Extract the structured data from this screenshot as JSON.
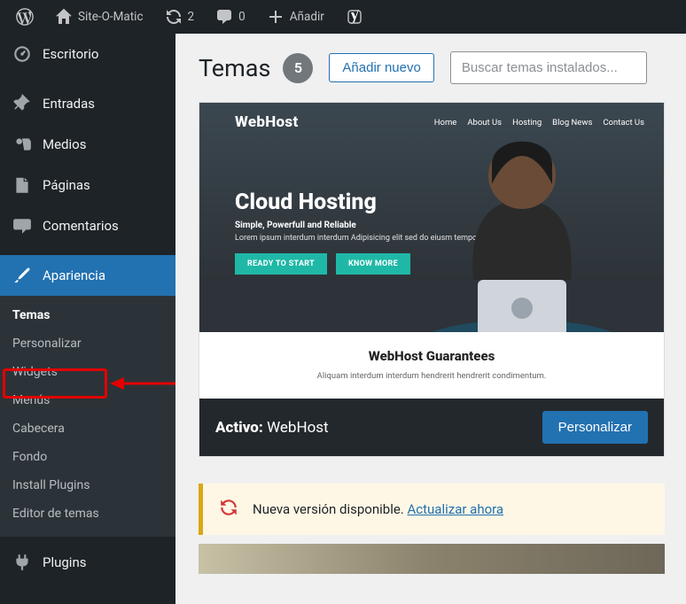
{
  "adminbar": {
    "site_name": "Site-O-Matic",
    "updates_count": "2",
    "comments_count": "0",
    "add_label": "Añadir"
  },
  "sidebar": {
    "items": [
      {
        "label": "Escritorio"
      },
      {
        "label": "Entradas"
      },
      {
        "label": "Medios"
      },
      {
        "label": "Páginas"
      },
      {
        "label": "Comentarios"
      },
      {
        "label": "Apariencia"
      },
      {
        "label": "Plugins"
      }
    ],
    "appearance_submenu": [
      {
        "label": "Temas"
      },
      {
        "label": "Personalizar"
      },
      {
        "label": "Widgets"
      },
      {
        "label": "Menús"
      },
      {
        "label": "Cabecera"
      },
      {
        "label": "Fondo"
      },
      {
        "label": "Install Plugins"
      },
      {
        "label": "Editor de temas"
      }
    ]
  },
  "page": {
    "title": "Temas",
    "count": "5",
    "add_new": "Añadir nuevo",
    "search_placeholder": "Buscar temas instalados..."
  },
  "theme_card": {
    "logo": "WebHost",
    "nav": [
      "Home",
      "About Us",
      "Hosting",
      "Blog News",
      "Contact Us"
    ],
    "hero_title": "Cloud Hosting",
    "hero_sub": "Simple, Powerfull and Reliable",
    "hero_lorem": "Lorem ipsum interdum interdum Adipisicing elit sed do eiusm tempor",
    "cta1": "READY TO START",
    "cta2": "KNOW MORE",
    "guarantees_title": "WebHost Guarantees",
    "guarantees_sub": "Aliquam interdum interdum hendrerit hendrerit condimentum.",
    "active_prefix": "Activo:",
    "active_name": "WebHost",
    "customize": "Personalizar"
  },
  "notice": {
    "text": "Nueva versión disponible. ",
    "link": "Actualizar ahora"
  }
}
